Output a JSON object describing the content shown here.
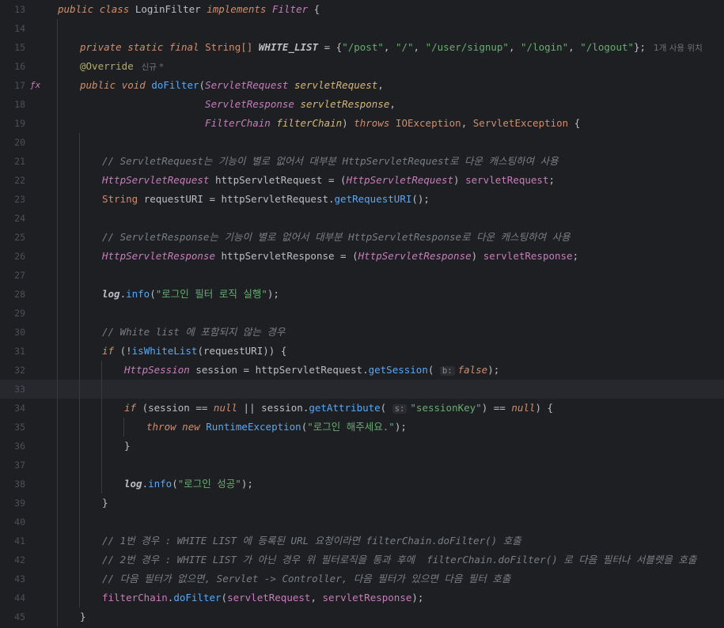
{
  "editor": {
    "language": "Java",
    "gutter_icon": "ƒx",
    "lines": [
      {
        "n": "13"
      },
      {
        "n": "14"
      },
      {
        "n": "15"
      },
      {
        "n": "16"
      },
      {
        "n": "17"
      },
      {
        "n": "18"
      },
      {
        "n": "19"
      },
      {
        "n": "20"
      },
      {
        "n": "21"
      },
      {
        "n": "22"
      },
      {
        "n": "23"
      },
      {
        "n": "24"
      },
      {
        "n": "25"
      },
      {
        "n": "26"
      },
      {
        "n": "27"
      },
      {
        "n": "28"
      },
      {
        "n": "29"
      },
      {
        "n": "30"
      },
      {
        "n": "31"
      },
      {
        "n": "32"
      },
      {
        "n": "33"
      },
      {
        "n": "34"
      },
      {
        "n": "35"
      },
      {
        "n": "36"
      },
      {
        "n": "37"
      },
      {
        "n": "38"
      },
      {
        "n": "39"
      },
      {
        "n": "40"
      },
      {
        "n": "41"
      },
      {
        "n": "42"
      },
      {
        "n": "43"
      },
      {
        "n": "44"
      },
      {
        "n": "45"
      }
    ],
    "inlay": {
      "usages": "1개 사용 위치",
      "new_tag": "신규 *",
      "hint_b": "b:",
      "hint_s": "s:"
    },
    "text": {
      "t_public": "public",
      "t_class": "class",
      "t_LoginFilter": "LoginFilter",
      "t_implements": "implements",
      "t_Filter": "Filter",
      "t_lbrace": "{",
      "t_private": "private",
      "t_static": "static",
      "t_final": "final",
      "t_StringArr": "String[]",
      "t_WHITE_LIST": "WHITE_LIST",
      "t_assign_open": " = {",
      "s_post": "\"/post\"",
      "s_root": "\"/\"",
      "s_signup": "\"/user/signup\"",
      "s_login": "\"/login\"",
      "s_logout": "\"/logout\"",
      "t_close_arr": "};",
      "t_override": "@Override",
      "t_void": "void",
      "t_doFilter": "doFilter",
      "t_ServletRequest": "ServletRequest",
      "t_servletRequest": "servletRequest",
      "t_ServletResponse": "ServletResponse",
      "t_servletResponse": "servletResponse",
      "t_FilterChain": "FilterChain",
      "t_filterChain": "filterChain",
      "t_throws": "throws",
      "t_IOException": "IOException",
      "t_ServletException": "ServletException",
      "c21": "// ServletRequest는 기능이 별로 없어서 대부분 HttpServletRequest로 다운 캐스팅하여 사용",
      "t_HttpServletRequest": "HttpServletRequest",
      "t_httpServletRequest": "httpServletRequest",
      "t_String": "String",
      "t_requestURI": "requestURI",
      "t_getRequestURI": "getRequestURI",
      "c25": "// ServletResponse는 기능이 별로 없어서 대부분 HttpServletResponse로 다운 캐스팅하여 사용",
      "t_HttpServletResponse": "HttpServletResponse",
      "t_httpServletResponse": "httpServletResponse",
      "t_log": "log",
      "t_info": "info",
      "s_login_logic": "\"로그인 필터 로직 실행\"",
      "c30": "// White list 에 포함되지 않는 경우",
      "t_if": "if",
      "t_isWhiteList": "isWhiteList",
      "t_HttpSession": "HttpSession",
      "t_session": "session",
      "t_getSession": "getSession",
      "t_false": "false",
      "t_null": "null",
      "t_getAttribute": "getAttribute",
      "s_sessionKey": "\"sessionKey\"",
      "t_throw": "throw",
      "t_new": "new",
      "t_RuntimeException": "RuntimeException",
      "s_please_login": "\"로그인 해주세요.\"",
      "t_rbrace": "}",
      "s_login_ok": "\"로그인 성공\"",
      "c41": "// 1번 경우 : WHITE LIST 에 등록된 URL 요청이라면 filterChain.doFilter() 호출",
      "c42": "// 2번 경우 : WHITE LIST 가 아닌 경우 위 필터로직을 통과 후에  filterChain.doFilter() 로 다음 필터나 서블렛을 호출",
      "c43": "// 다음 필터가 없으면, Servlet -> Controller, 다음 필터가 있으면 다음 필터 호출"
    }
  }
}
